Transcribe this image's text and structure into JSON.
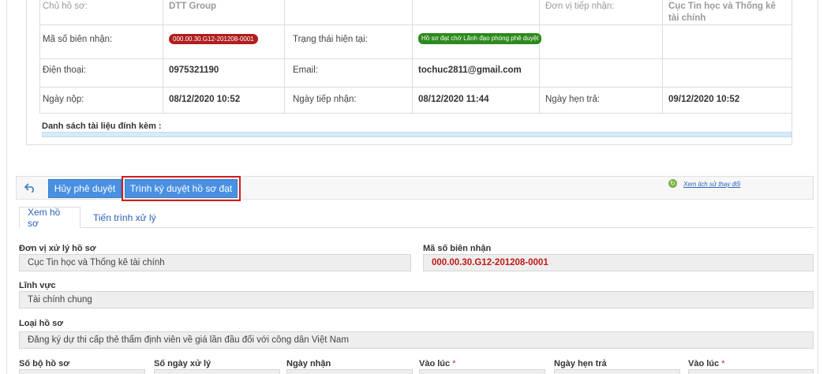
{
  "info": {
    "top_row": {
      "label1": "Chủ hồ sơ:",
      "value1": "DTT Group",
      "label2": "Đơn vị tiếp nhận:",
      "value2": "Cục Tin học và Thống kê tài chính"
    },
    "receipt_label": "Mã số biên nhận:",
    "receipt_value": "000.00.30.G12-201208-0001",
    "status_label": "Trạng thái hiện tại:",
    "status_value": "Hồ sơ đạt chờ Lãnh đạo phòng phê duyệt",
    "phone_label": "Điện thoại:",
    "phone_value": "0975321190",
    "email_label": "Email:",
    "email_value": "tochuc2811@gmail.com",
    "submit_label": "Ngày nộp:",
    "submit_value": "08/12/2020 10:52",
    "received_label": "Ngày tiếp nhận:",
    "received_value": "08/12/2020 11:44",
    "due_label": "Ngày hẹn trả:",
    "due_value": "09/12/2020 10:52",
    "attachments_label": "Danh sách tài liệu đính kèm :"
  },
  "toolbar": {
    "cancel_label": "Hủy phê duyệt",
    "submit_label": "Trình ký duyệt hồ sơ đạt",
    "history_link": "Xem lịch sử thay đổi"
  },
  "tabs": [
    {
      "label": "Xem hồ sơ"
    },
    {
      "label": "Tiến trình xử lý"
    }
  ],
  "form": {
    "unit_label": "Đơn vị xử lý hồ sơ",
    "unit_value": "Cục Tin học và Thống kê tài chính",
    "receipt_label": "Mã số biên nhận",
    "receipt_value": "000.00.30.G12-201208-0001",
    "field_label": "Lĩnh vực",
    "field_value": "Tài chính chung",
    "type_label": "Loại hồ sơ",
    "type_value": "Đăng ký dự thi cấp thẻ thẩm định viên về giá lần đầu đối với công dân Việt Nam",
    "bottom_labels": [
      "Số bộ hồ sơ",
      "Số ngày xử lý",
      "Ngày nhận",
      "Vào lúc",
      "Ngày hẹn trả",
      "Vào lúc"
    ]
  },
  "colors": {
    "accent": "#4a90e2",
    "highlight": "#d11d1d",
    "status_green": "#2d8a1c",
    "receipt_red": "#b01e1e"
  }
}
